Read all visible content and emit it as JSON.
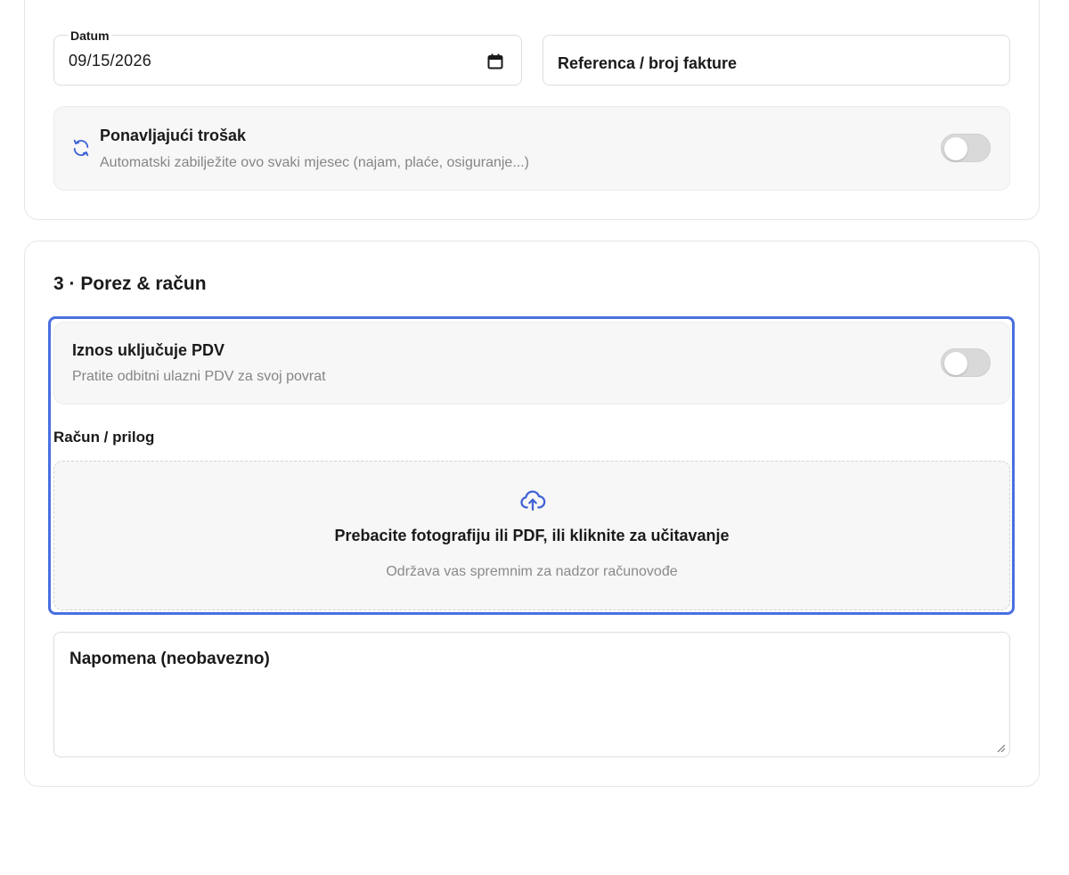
{
  "recurring": {
    "title": "Ponavljajući trošak",
    "subtitle": "Automatski zabilježite ovo svaki mjesec (najam, plaće, osiguranje...)",
    "enabled": false,
    "icon": "refresh-icon"
  },
  "date_field": {
    "label": "Datum",
    "value": "09/15/2026",
    "icon": "calendar-icon"
  },
  "reference_field": {
    "placeholder": "Referenca / broj fakture"
  },
  "tax_section": {
    "title": "3 · Porez & račun",
    "vat_toggle": {
      "title": "Iznos uključuje PDV",
      "subtitle": "Pratite odbitni ulazni PDV za svoj povrat",
      "enabled": false
    },
    "receipt": {
      "label": "Račun / prilog",
      "upload_title": "Prebacite fotografiju ili PDF, ili kliknite za učitavanje",
      "upload_hint": "Održava vas spremnim za nadzor računovođe",
      "icon": "cloud-upload-icon"
    },
    "note": {
      "placeholder": "Napomena (neobavezno)"
    }
  },
  "colors": {
    "accent": "#4a6fe0",
    "icon_blue": "#3f63d6",
    "panel_bg": "#f7f7f7",
    "muted_text": "#858585"
  }
}
